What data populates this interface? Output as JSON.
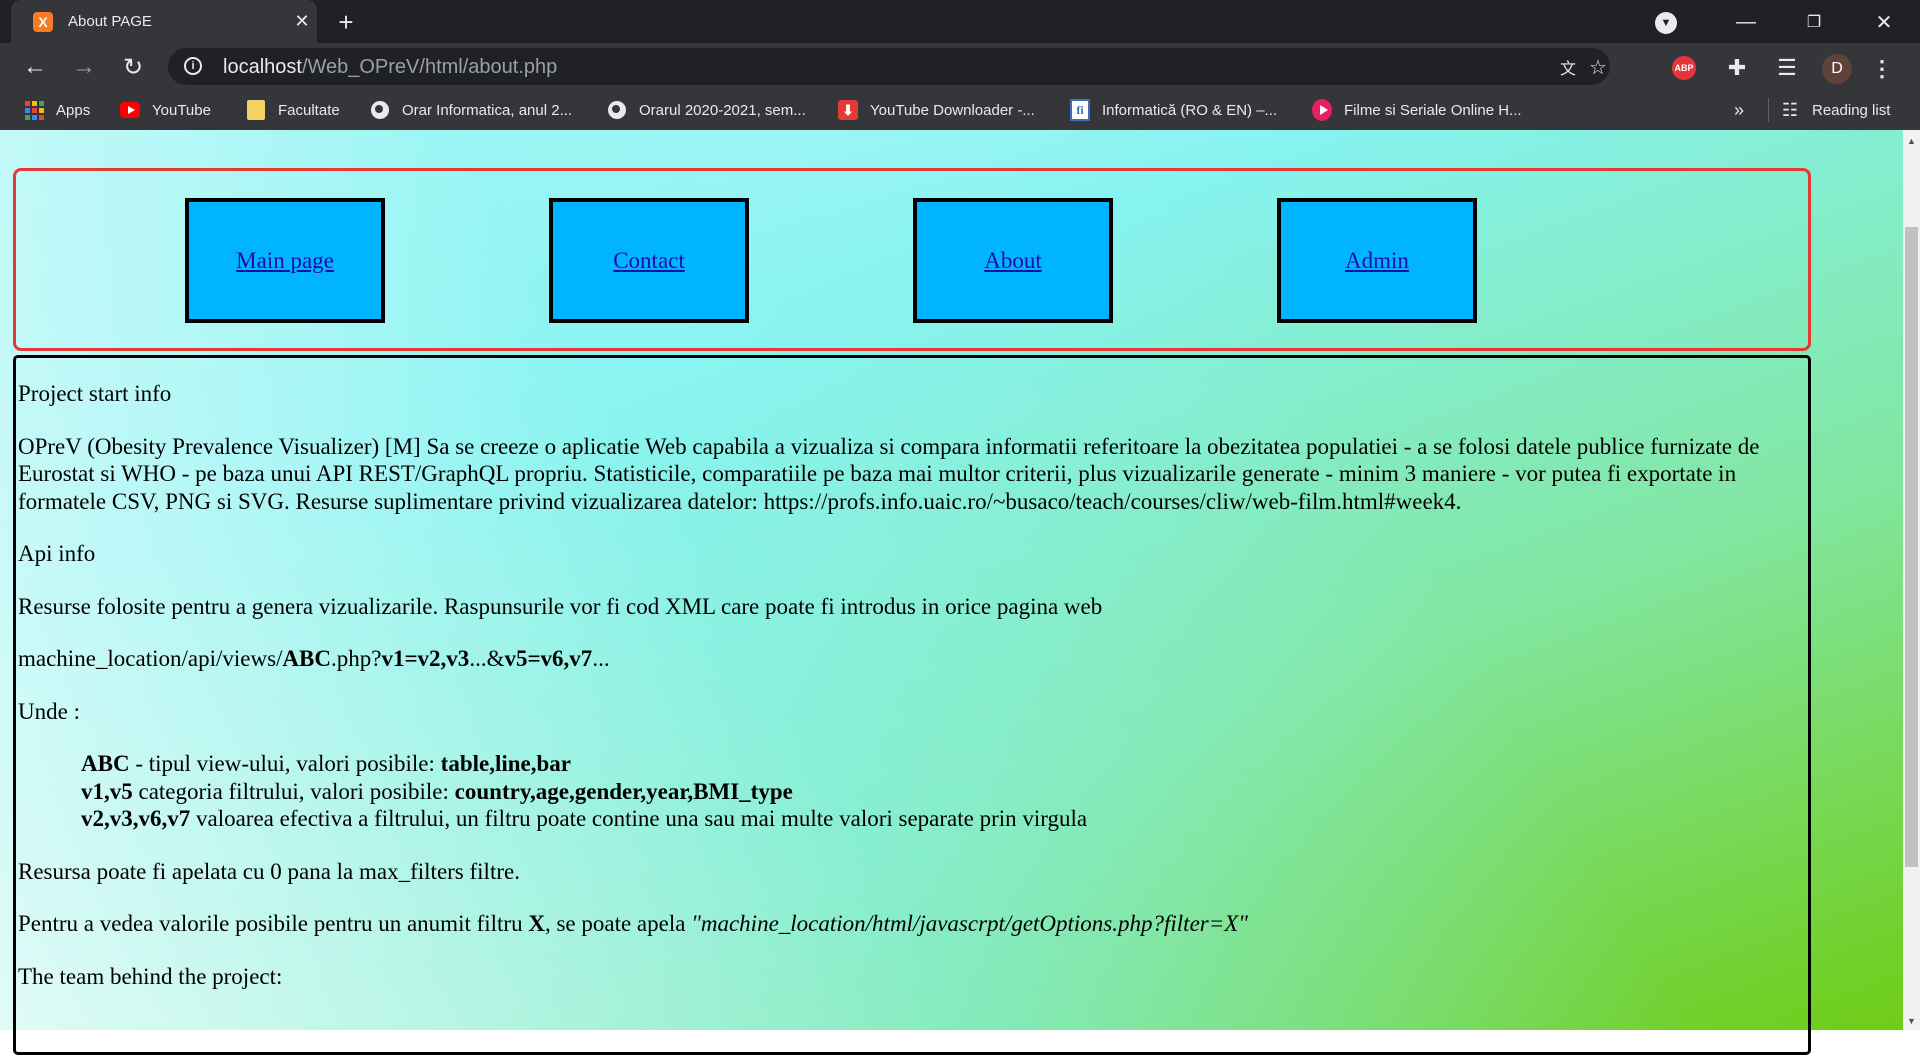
{
  "browser": {
    "tab": {
      "favicon": "X",
      "title": "About PAGE",
      "close_icon": "close-icon"
    },
    "newtab_label": "+",
    "window": {
      "minimize": "—",
      "restore": "❐",
      "close": "✕"
    },
    "url": {
      "host": "localhost",
      "path": "/Web_OPreV/html/about.php"
    },
    "bookmarks": [
      {
        "label": "Apps",
        "icon": "apps-grid-icon"
      },
      {
        "label": "YouTube",
        "icon": "youtube-icon"
      },
      {
        "label": "Facultate",
        "icon": "folder-icon"
      },
      {
        "label": "Orar Informatica, anul 2...",
        "icon": "globe-icon"
      },
      {
        "label": "Orarul 2020-2021, sem...",
        "icon": "globe-icon"
      },
      {
        "label": "YouTube Downloader -...",
        "icon": "download-icon"
      },
      {
        "label": "Informatică (RO & EN) –...",
        "icon": "info-faculty-icon"
      },
      {
        "label": "Filme si Seriale Online H...",
        "icon": "play-icon"
      }
    ],
    "bookmarks_overflow": "»",
    "reading_list": "Reading list",
    "extensions": {
      "abp": "ABP"
    },
    "avatar_letter": "D"
  },
  "nav": {
    "items": [
      {
        "label": "Main page"
      },
      {
        "label": "Contact"
      },
      {
        "label": "About"
      },
      {
        "label": "Admin"
      }
    ]
  },
  "content": {
    "project_heading": "Project start info",
    "project_desc": "OPreV (Obesity Prevalence Visualizer) [M] Sa se creeze o aplicatie Web capabila a vizualiza si compara informatii referitoare la obezitatea populatiei - a se folosi datele publice furnizate de Eurostat si WHO - pe baza unui API REST/GraphQL propriu. Statisticile, comparatiile pe baza mai multor criterii, plus vizualizarile generate - minim 3 maniere - vor putea fi exportate in formatele CSV, PNG si SVG. Resurse suplimentare privind vizualizarea datelor: https://profs.info.uaic.ro/~busaco/teach/courses/cliw/web-film.html#week4.",
    "api_heading": "Api info",
    "api_desc": "Resurse folosite pentru a genera vizualizarile. Raspunsurile vor fi cod XML care poate fi introdus in orice pagina web",
    "endpoint": {
      "p1": "machine_location/api/views/",
      "p2": "ABC",
      "p3": ".php?",
      "p4": "v1=v2,v3",
      "p5": "...&",
      "p6": "v5=v6,v7",
      "p7": "..."
    },
    "unde": "Unde :",
    "params": [
      {
        "name": "ABC",
        "desc": " - tipul view-ului, valori posibile: ",
        "values": "table,line,bar"
      },
      {
        "name": "v1,v5",
        "desc": " categoria filtrului, valori posibile: ",
        "values": "country,age,gender,year,BMI_type"
      },
      {
        "name": "v2,v3,v6,v7",
        "desc": " valoarea efectiva a filtrului, un filtru poate contine una sau mai multe valori separate prin virgula",
        "values": ""
      }
    ],
    "resource_note": "Resursa poate fi apelata cu 0 pana la max_filters filtre.",
    "options": {
      "p1": "Pentru a vedea valorile posibile pentru un anumit filtru ",
      "p2": "X",
      "p3": ", se poate apela ",
      "p4": "\"machine_location/html/javascrpt/getOptions.php?filter=X\""
    },
    "team_heading": "The team behind the project:"
  }
}
